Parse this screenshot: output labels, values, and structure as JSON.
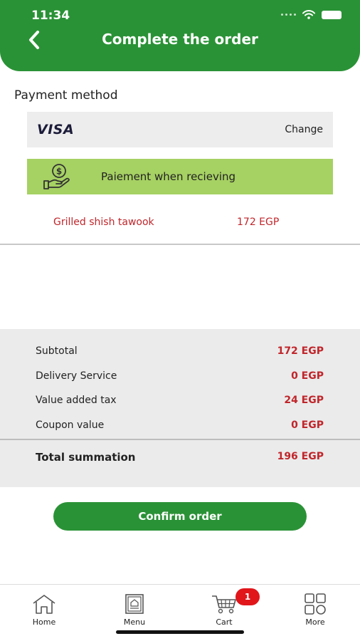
{
  "status_bar": {
    "time": "11:34",
    "icons": [
      "signal-dots-icon",
      "wifi-icon",
      "battery-icon"
    ]
  },
  "header": {
    "title": "Complete the order",
    "back_icon": "chevron-left-icon"
  },
  "payment": {
    "section_title": "Payment method",
    "card": {
      "brand": "VISA",
      "change_label": "Change"
    },
    "cash_option": {
      "label": "Paiement when recieving",
      "icon": "cash-hand-icon"
    }
  },
  "order_items": [
    {
      "name": "Grilled shish tawook",
      "price": "172 EGP"
    }
  ],
  "summary": {
    "rows": [
      {
        "label": "Subtotal",
        "value": "172 EGP"
      },
      {
        "label": "Delivery Service",
        "value": "0 EGP"
      },
      {
        "label": "Value added tax",
        "value": "24 EGP"
      },
      {
        "label": "Coupon value",
        "value": "0 EGP"
      }
    ],
    "total": {
      "label": "Total summation",
      "value": "196 EGP"
    }
  },
  "confirm_button": {
    "label": "Confirm order"
  },
  "tabbar": {
    "tabs": [
      {
        "label": "Home",
        "icon": "home-icon"
      },
      {
        "label": "Menu",
        "icon": "menu-book-icon"
      },
      {
        "label": "Cart",
        "icon": "cart-icon"
      },
      {
        "label": "More",
        "icon": "grid-icon"
      }
    ],
    "cart_badge": "1"
  },
  "colors": {
    "primary": "#2a9236",
    "cash_bg": "#a6d163",
    "price_red": "#c0262b",
    "badge_red": "#e0161b"
  }
}
